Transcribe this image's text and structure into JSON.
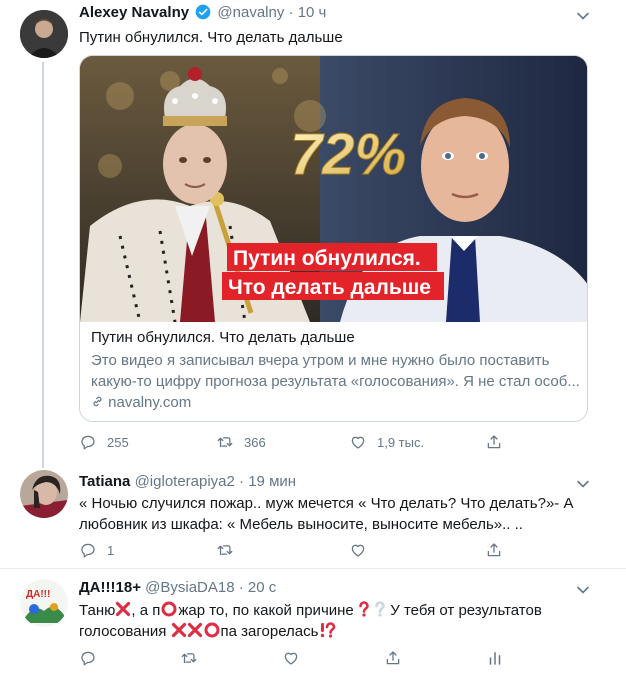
{
  "tweets": [
    {
      "name": "Alexey Navalny",
      "handle": "@navalny",
      "dot": "·",
      "time": "10 ч",
      "text": "Путин обнулился. Что делать дальше",
      "card": {
        "overlay_percent": "72%",
        "overlay_line1": "Путин обнулился.",
        "overlay_line2": "Что делать дальше",
        "title": "Путин обнулился. Что делать дальше",
        "desc_line1": "Это видео я записывал вчера утром и мне нужно было поставить",
        "desc_line2": "какую-то цифру прогноза результата «голосования». Я не стал особ...",
        "link": "navalny.com"
      },
      "replies": "255",
      "retweets": "366",
      "likes": "1,9 тыс."
    },
    {
      "name": "Tatiana",
      "handle": "@igloterapiya2",
      "dot": "·",
      "time": "19 мин",
      "text_line1": "« Ночью случился пожар..  муж мечется « Что делать? Что делать?»- А",
      "text_line2": "любовник из шкафа: « Мебель выносите, выносите мебель».. ..",
      "replies": "1"
    },
    {
      "name": "ДА!!!18+",
      "handle": "@BysiaDA18",
      "dot": "·",
      "time": "20 с",
      "avatar_text": "ДА!!!",
      "text_a": "Таню",
      "text_b": ", а п",
      "text_c": "жар то, по какой причине ",
      "text_d": "  У тебя от результатов",
      "text_e": "голосования ",
      "text_f": "па загорелась"
    }
  ],
  "colors": {
    "text": "#14171a",
    "secondary": "#657786",
    "verified": "#1da1f2",
    "emoji_red": "#dd2e44",
    "border": "#ccd6dd"
  },
  "icons": [
    "verified-icon",
    "chevron-down-icon",
    "reply-icon",
    "retweet-icon",
    "like-icon",
    "share-icon",
    "analytics-icon",
    "link-icon"
  ]
}
